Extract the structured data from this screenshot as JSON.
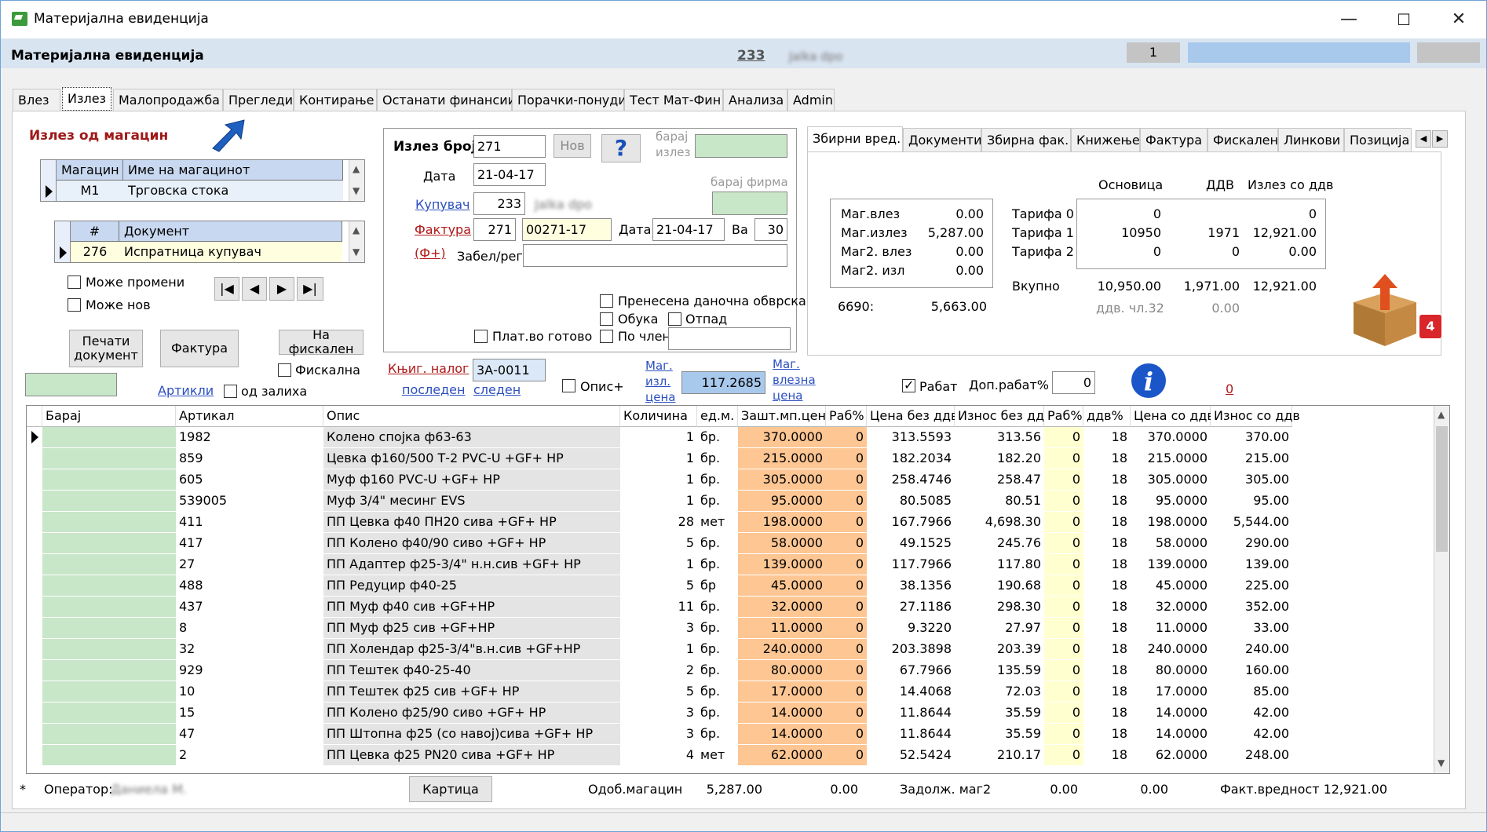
{
  "window": {
    "title": "Материјална евиденција"
  },
  "header": {
    "app_title": "Материјална евиденција",
    "doc_number": "233",
    "blurred_text": "Jalka dpo",
    "field_value": "1"
  },
  "tabs": [
    "Влез",
    "Излез",
    "Малопродажба",
    "Прегледи",
    "Контирање",
    "Останати финансии",
    "Порачки-понуди",
    "Тест Мат-Фин",
    "Анализа",
    "Admin"
  ],
  "warehouse": {
    "section_title": "Излез од магацин",
    "col_code": "Магацин",
    "col_name": "Име на магацинот",
    "row": {
      "code": "М1",
      "name": "Трговска стока"
    }
  },
  "document_grid": {
    "col_num": "#",
    "col_doc": "Документ",
    "row": {
      "num": "276",
      "doc": "Испратница купувач"
    }
  },
  "checkboxes": {
    "can_edit": "Може промени",
    "can_new": "Може нов"
  },
  "buttons": {
    "print": "Печати документ",
    "invoice": "Фактура",
    "to_fiscal": "На фискален",
    "fiscal": "Фискална",
    "articles": "Артикли",
    "from_stock": "од залиха",
    "new": "Нов",
    "help": "?",
    "card": "Картица"
  },
  "form": {
    "out_no_label": "Излез број",
    "out_no": "271",
    "date_label": "Дата",
    "date": "21-04-17",
    "search_out_label": "барај излез",
    "search_company_label": "барај фирма",
    "buyer_label": "Купувач",
    "buyer": "233",
    "buyer_name": "Jalka dpo",
    "invoice_label": "Фактура",
    "invoice_no": "271",
    "invoice_full": "00271-17",
    "inv_date_label": "Дата",
    "inv_date": "21-04-17",
    "va_label": "Ва",
    "va": "30",
    "fplus": "(Ф+)",
    "note_label": "Забел/рег",
    "transferred_tax": "Пренесена даночна обврска",
    "training": "Обука",
    "waste": "Отпад",
    "paid_cash": "Плат.во готово",
    "per_member": "По член",
    "book_order": "Књиг. налог",
    "book_value": "3А-0011",
    "last": "последен",
    "next": "следен",
    "desc_plus": "Опис+",
    "mag_out_price": "Маг. изл. цена",
    "mag_out_value": "117.2685",
    "mag_in_price": "Маг. влезна цена",
    "discount": "Рабат",
    "extra_discount": "Доп.рабат%",
    "extra_discount_value": "0",
    "red_zero": "0"
  },
  "summary_tabs": [
    "Збирни вред.",
    "Документи",
    "Збирна фак.",
    "Книжење",
    "Фактура",
    "Фискален",
    "Линкови",
    "Позиција"
  ],
  "summary": {
    "left": [
      {
        "label": "Маг.влез",
        "value": "0.00"
      },
      {
        "label": "Маг.излез",
        "value": "5,287.00"
      },
      {
        "label": "Маг2. влез",
        "value": "0.00"
      },
      {
        "label": "Маг2. изл",
        "value": "0.00"
      }
    ],
    "code": "6690:",
    "code_value": "5,663.00",
    "headers": {
      "base": "Основица",
      "vat": "ДДВ",
      "with_vat": "Излез со ддв"
    },
    "tariffs": [
      {
        "label": "Тарифа 0",
        "base": "0",
        "vat": "",
        "total": "0"
      },
      {
        "label": "Тарифа 1",
        "base": "10950",
        "vat": "1971",
        "total": "12,921.00"
      },
      {
        "label": "Тарифа 2",
        "base": "0",
        "vat": "0",
        "total": "0.00"
      }
    ],
    "total_label": "Вкупно",
    "total_base": "10,950.00",
    "total_vat": "1,971.00",
    "total_all": "12,921.00",
    "art32_label": "ддв. чл.32",
    "art32_value": "0.00"
  },
  "table": {
    "headers": [
      "Барај",
      "Артикал",
      "Опис",
      "Количина",
      "ед.м.",
      "Зашт.мп.цена",
      "Раб%",
      "Цена без ддв",
      "Износ без ддв",
      "Раб%",
      "ддв%",
      "Цена со ддв",
      "Износ со ддв"
    ],
    "rows": [
      [
        "",
        "1982",
        "Колено спојка ф63-63",
        "1",
        "бр.",
        "370.0000",
        "0",
        "313.5593",
        "313.56",
        "0",
        "18",
        "370.0000",
        "370.00"
      ],
      [
        "",
        "859",
        "Цевка ф160/500 Т-2 PVC-U +GF+ HP",
        "1",
        "бр.",
        "215.0000",
        "0",
        "182.2034",
        "182.20",
        "0",
        "18",
        "215.0000",
        "215.00"
      ],
      [
        "",
        "605",
        "Муф ф160  PVC-U +GF+ HP",
        "1",
        "бр.",
        "305.0000",
        "0",
        "258.4746",
        "258.47",
        "0",
        "18",
        "305.0000",
        "305.00"
      ],
      [
        "",
        "539005",
        "Муф 3/4\" месинг EVS",
        "1",
        "бр.",
        "95.0000",
        "0",
        "80.5085",
        "80.51",
        "0",
        "18",
        "95.0000",
        "95.00"
      ],
      [
        "",
        "411",
        "ПП Цевка ф40 ПН20 сива +GF+ HP",
        "28",
        "мет",
        "198.0000",
        "0",
        "167.7966",
        "4,698.30",
        "0",
        "18",
        "198.0000",
        "5,544.00"
      ],
      [
        "",
        "417",
        "ПП Колено ф40/90 сиво +GF+ HP",
        "5",
        "бр.",
        "58.0000",
        "0",
        "49.1525",
        "245.76",
        "0",
        "18",
        "58.0000",
        "290.00"
      ],
      [
        "",
        "27",
        "ПП Адаптер ф25-3/4\" н.н.сив +GF+ HP",
        "1",
        "бр.",
        "139.0000",
        "0",
        "117.7966",
        "117.80",
        "0",
        "18",
        "139.0000",
        "139.00"
      ],
      [
        "",
        "488",
        "ПП Редуцир ф40-25",
        "5",
        "бр",
        "45.0000",
        "0",
        "38.1356",
        "190.68",
        "0",
        "18",
        "45.0000",
        "225.00"
      ],
      [
        "",
        "437",
        "ПП Муф ф40 сив +GF+HP",
        "11",
        "бр.",
        "32.0000",
        "0",
        "27.1186",
        "298.30",
        "0",
        "18",
        "32.0000",
        "352.00"
      ],
      [
        "",
        "8",
        "ПП Муф ф25 сив +GF+HP",
        "3",
        "бр.",
        "11.0000",
        "0",
        "9.3220",
        "27.97",
        "0",
        "18",
        "11.0000",
        "33.00"
      ],
      [
        "",
        "32",
        "ПП Холендар ф25-3/4\"в.н.сив +GF+HP",
        "1",
        "бр.",
        "240.0000",
        "0",
        "203.3898",
        "203.39",
        "0",
        "18",
        "240.0000",
        "240.00"
      ],
      [
        "",
        "929",
        "ПП Тештек ф40-25-40",
        "2",
        "бр.",
        "80.0000",
        "0",
        "67.7966",
        "135.59",
        "0",
        "18",
        "80.0000",
        "160.00"
      ],
      [
        "",
        "10",
        "ПП Тештек ф25 сив +GF+ HP",
        "5",
        "бр.",
        "17.0000",
        "0",
        "14.4068",
        "72.03",
        "0",
        "18",
        "17.0000",
        "85.00"
      ],
      [
        "",
        "15",
        "ПП Колено ф25/90 сиво +GF+ HP",
        "3",
        "бр.",
        "14.0000",
        "0",
        "11.8644",
        "35.59",
        "0",
        "18",
        "14.0000",
        "42.00"
      ],
      [
        "",
        "47",
        "ПП Штопна ф25 (со навој)сива +GF+ HP",
        "3",
        "бр.",
        "14.0000",
        "0",
        "11.8644",
        "35.59",
        "0",
        "18",
        "14.0000",
        "42.00"
      ],
      [
        "",
        "2",
        "ПП Цевка ф25 PN20 сива +GF+ HP",
        "4",
        "мет",
        "62.0000",
        "0",
        "52.5424",
        "210.17",
        "0",
        "18",
        "62.0000",
        "248.00"
      ]
    ]
  },
  "footer": {
    "star": "*",
    "operator_label": "Оператор:",
    "operator_name": "Даниела М.",
    "approved_label": "Одоб.магацин",
    "approved_value": "5,287.00",
    "approved_value2": "0.00",
    "debt_label": "Задолж. маг2",
    "debt_value": "0.00",
    "debt_value2": "0.00",
    "invoice_value_label": "Факт.вредност",
    "invoice_value": "12,921.00"
  }
}
